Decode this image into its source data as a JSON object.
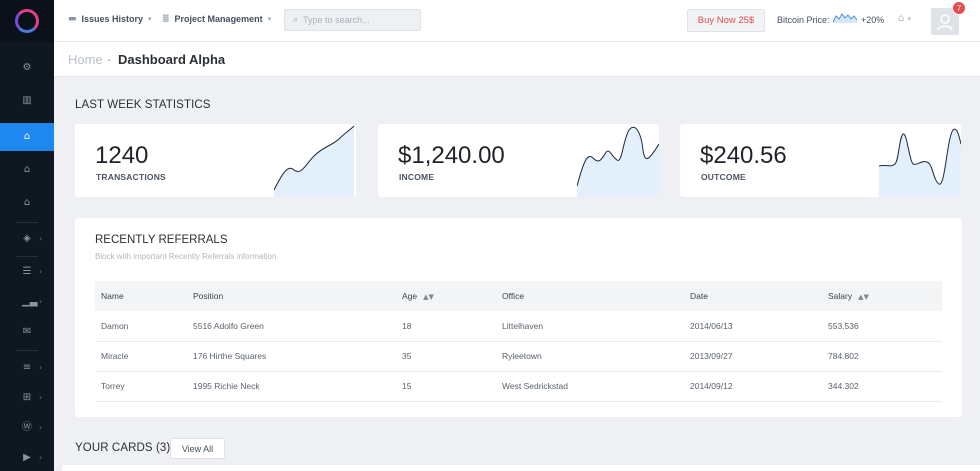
{
  "header": {
    "nav": [
      {
        "label": "Issues History",
        "icon": "folder-icon"
      },
      {
        "label": "Project Management",
        "icon": "stack-icon"
      }
    ],
    "search_placeholder": "Type to search...",
    "buy_label": "Buy Now 25$",
    "bitcoin_label": "Bitcoin Price:",
    "bitcoin_change": "+20%",
    "notification_count": "7"
  },
  "breadcrumb": {
    "home": "Home",
    "separator": "·",
    "current": "Dashboard Alpha"
  },
  "stats": {
    "title": "LAST WEEK STATISTICS",
    "cards": [
      {
        "value": "1240",
        "label": "TRANSACTIONS"
      },
      {
        "value": "$1,240.00",
        "label": "INCOME"
      },
      {
        "value": "$240.56",
        "label": "OUTCOME"
      }
    ]
  },
  "referrals": {
    "title": "RECENTLY REFERRALS",
    "subtitle": "Block with important Recently Referrals information",
    "columns": [
      "Name",
      "Position",
      "Age",
      "Office",
      "Date",
      "Salary"
    ],
    "rows": [
      [
        "Damon",
        "5516 Adolfo Green",
        "18",
        "Littelhaven",
        "2014/06/13",
        "553.536"
      ],
      [
        "Miracle",
        "176 Hirthe Squares",
        "35",
        "Ryleetown",
        "2013/09/27",
        "784.802"
      ],
      [
        "Torrey",
        "1995 Richie Neck",
        "15",
        "West Sedrickstad",
        "2014/09/12",
        "344.302"
      ]
    ]
  },
  "cards_section": {
    "title": "YOUR CARDS (3)",
    "view_all": "View All"
  },
  "colors": {
    "accent": "#1e88f0",
    "sidebar_bg": "#0f1720",
    "danger": "#e84c4c",
    "sparkline_fill": "#e3f0fc",
    "sparkline_stroke": "#1a2a3a"
  }
}
